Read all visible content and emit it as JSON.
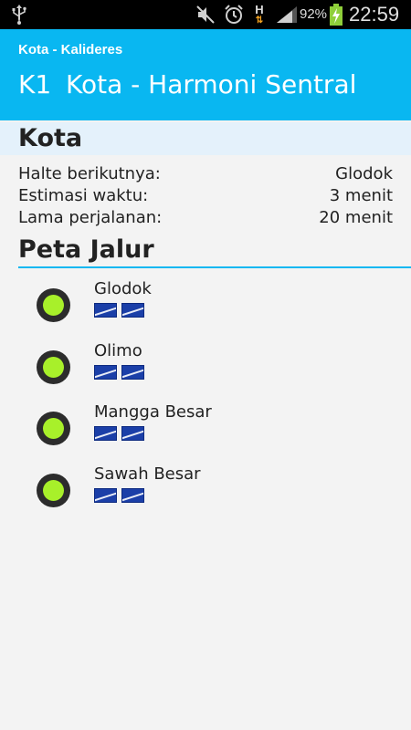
{
  "status_bar": {
    "battery_percent": "92%",
    "time": "22:59",
    "network_type": "H"
  },
  "header": {
    "subtitle": "Kota - Kalideres",
    "route_code": "K1",
    "route_name": "Kota - Harmoni Sentral"
  },
  "section": {
    "title": "Kota"
  },
  "info": [
    {
      "label": "Halte berikutnya:",
      "value": "Glodok"
    },
    {
      "label": "Estimasi waktu:",
      "value": "3 menit"
    },
    {
      "label": "Lama perjalanan:",
      "value": "20 menit"
    }
  ],
  "route_map": {
    "title": "Peta Jalur",
    "stops": [
      {
        "name": "Glodok"
      },
      {
        "name": "Olimo"
      },
      {
        "name": "Mangga Besar"
      },
      {
        "name": "Sawah Besar"
      }
    ]
  },
  "colors": {
    "accent": "#09b7f1",
    "stop_active": "#a8f02a",
    "stop_ring": "#2c2c2c",
    "badge": "#1b3fa8"
  }
}
